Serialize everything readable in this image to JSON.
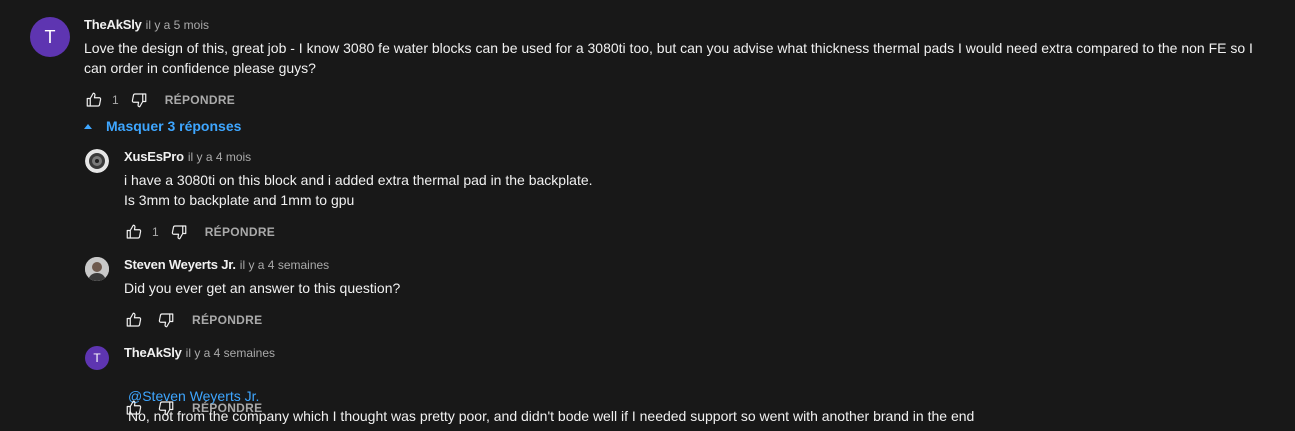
{
  "comments": {
    "main": {
      "avatar_letter": "T",
      "author": "TheAkSly",
      "time": "il y a 5 mois",
      "text": "Love the design of this, great job - I know 3080 fe water blocks can be used for a 3080ti too, but can you advise what thickness thermal pads I would need extra compared to the non FE so I\ncan order in confidence please guys?",
      "likes": "1",
      "reply_label": "RÉPONDRE"
    },
    "toggle_label": "Masquer 3 réponses",
    "replies": [
      {
        "author": "XusEsPro",
        "time": "il y a 4 mois",
        "text": "i have a 3080ti on this block and i added extra thermal pad in the backplate.\nIs 3mm to backplate and 1mm to gpu",
        "likes": "1",
        "reply_label": "RÉPONDRE"
      },
      {
        "author": "Steven Weyerts Jr.",
        "time": "il y a 4 semaines",
        "text": "Did you ever get an answer to this question?",
        "likes": "",
        "reply_label": "RÉPONDRE"
      },
      {
        "avatar_letter": "T",
        "author": "TheAkSly",
        "time": "il y a 4 semaines",
        "mention": "@Steven Weyerts Jr.",
        "text": "No, not from the company which I thought was pretty poor, and didn't bode well if I needed support so went with another brand in the end",
        "likes": "",
        "reply_label": "RÉPONDRE"
      }
    ]
  },
  "colors": {
    "background": "#181818",
    "accent": "#3ea6ff",
    "avatar_purple": "#5e35b1"
  },
  "icons": {
    "like": "thumbs-up-icon",
    "dislike": "thumbs-down-icon",
    "caret": "caret-up-icon"
  }
}
